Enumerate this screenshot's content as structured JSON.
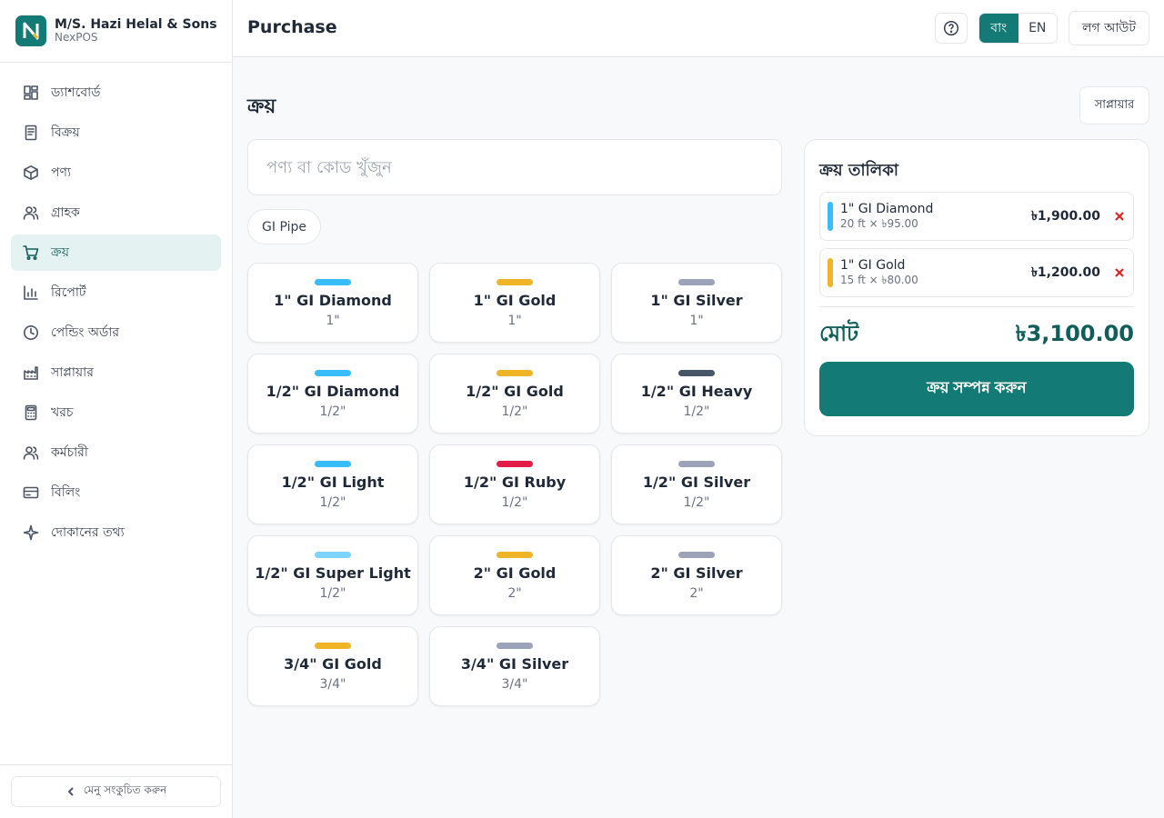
{
  "brand": {
    "name": "M/S. Hazi Helal & Sons",
    "sub": "NexPOS",
    "logo_letter": "N"
  },
  "sidebar": {
    "items": [
      {
        "label": "ড্যাশবোর্ড",
        "icon": "dashboard-icon"
      },
      {
        "label": "বিক্রয়",
        "icon": "receipt-icon"
      },
      {
        "label": "পণ্য",
        "icon": "box-icon"
      },
      {
        "label": "গ্রাহক",
        "icon": "users-icon"
      },
      {
        "label": "ক্রয়",
        "icon": "cart-icon",
        "active": true
      },
      {
        "label": "রিপোর্ট",
        "icon": "bar-chart-icon"
      },
      {
        "label": "পেন্ডিং অর্ডার",
        "icon": "clock-icon"
      },
      {
        "label": "সাপ্লায়ার",
        "icon": "factory-icon"
      },
      {
        "label": "খরচ",
        "icon": "calculator-icon"
      },
      {
        "label": "কর্মচারী",
        "icon": "team-icon"
      },
      {
        "label": "বিলিং",
        "icon": "credit-card-icon"
      },
      {
        "label": "দোকানের তথ্য",
        "icon": "sparkle-icon"
      }
    ],
    "collapse_label": "মেনু সংকুচিত করুন"
  },
  "header": {
    "title": "Purchase",
    "lang_bn": "বাং",
    "lang_en": "EN",
    "logout": "লগ আউট"
  },
  "main": {
    "title": "ক্রয়",
    "supplier_button": "সাপ্লায়ার",
    "search_placeholder": "পণ্য বা কোড খুঁজুন",
    "chip": "GI Pipe",
    "products": [
      {
        "name": "1\" GI Diamond",
        "size": "1\"",
        "color": "#38bdf8"
      },
      {
        "name": "1\" GI Gold",
        "size": "1\"",
        "color": "#f0b429"
      },
      {
        "name": "1\" GI Silver",
        "size": "1\"",
        "color": "#9ca3b8"
      },
      {
        "name": "1/2\" GI Diamond",
        "size": "1/2\"",
        "color": "#38bdf8"
      },
      {
        "name": "1/2\" GI Gold",
        "size": "1/2\"",
        "color": "#f0b429"
      },
      {
        "name": "1/2\" GI Heavy",
        "size": "1/2\"",
        "color": "#475569"
      },
      {
        "name": "1/2\" GI Light",
        "size": "1/2\"",
        "color": "#38bdf8"
      },
      {
        "name": "1/2\" GI Ruby",
        "size": "1/2\"",
        "color": "#e11d48"
      },
      {
        "name": "1/2\" GI Silver",
        "size": "1/2\"",
        "color": "#9ca3b8"
      },
      {
        "name": "1/2\" GI Super Light",
        "size": "1/2\"",
        "color": "#7dd3fc"
      },
      {
        "name": "2\" GI Gold",
        "size": "2\"",
        "color": "#f0b429"
      },
      {
        "name": "2\" GI Silver",
        "size": "2\"",
        "color": "#9ca3b8"
      },
      {
        "name": "3/4\" GI Gold",
        "size": "3/4\"",
        "color": "#f0b429"
      },
      {
        "name": "3/4\" GI Silver",
        "size": "3/4\"",
        "color": "#9ca3b8"
      }
    ]
  },
  "cart": {
    "title": "ক্রয় তালিকা",
    "items": [
      {
        "name": "1\" GI Diamond",
        "detail": "20 ft × ৳95.00",
        "amount": "৳1,900.00",
        "color": "#38bdf8"
      },
      {
        "name": "1\" GI Gold",
        "detail": "15 ft × ৳80.00",
        "amount": "৳1,200.00",
        "color": "#f0b429"
      }
    ],
    "total_label": "মোট",
    "total_value": "৳3,100.00",
    "complete_button": "ক্রয় সম্পন্ন করুন"
  },
  "colors": {
    "accent": "#137a75",
    "accent_dark": "#0f5e5a",
    "danger": "#dc2626"
  }
}
